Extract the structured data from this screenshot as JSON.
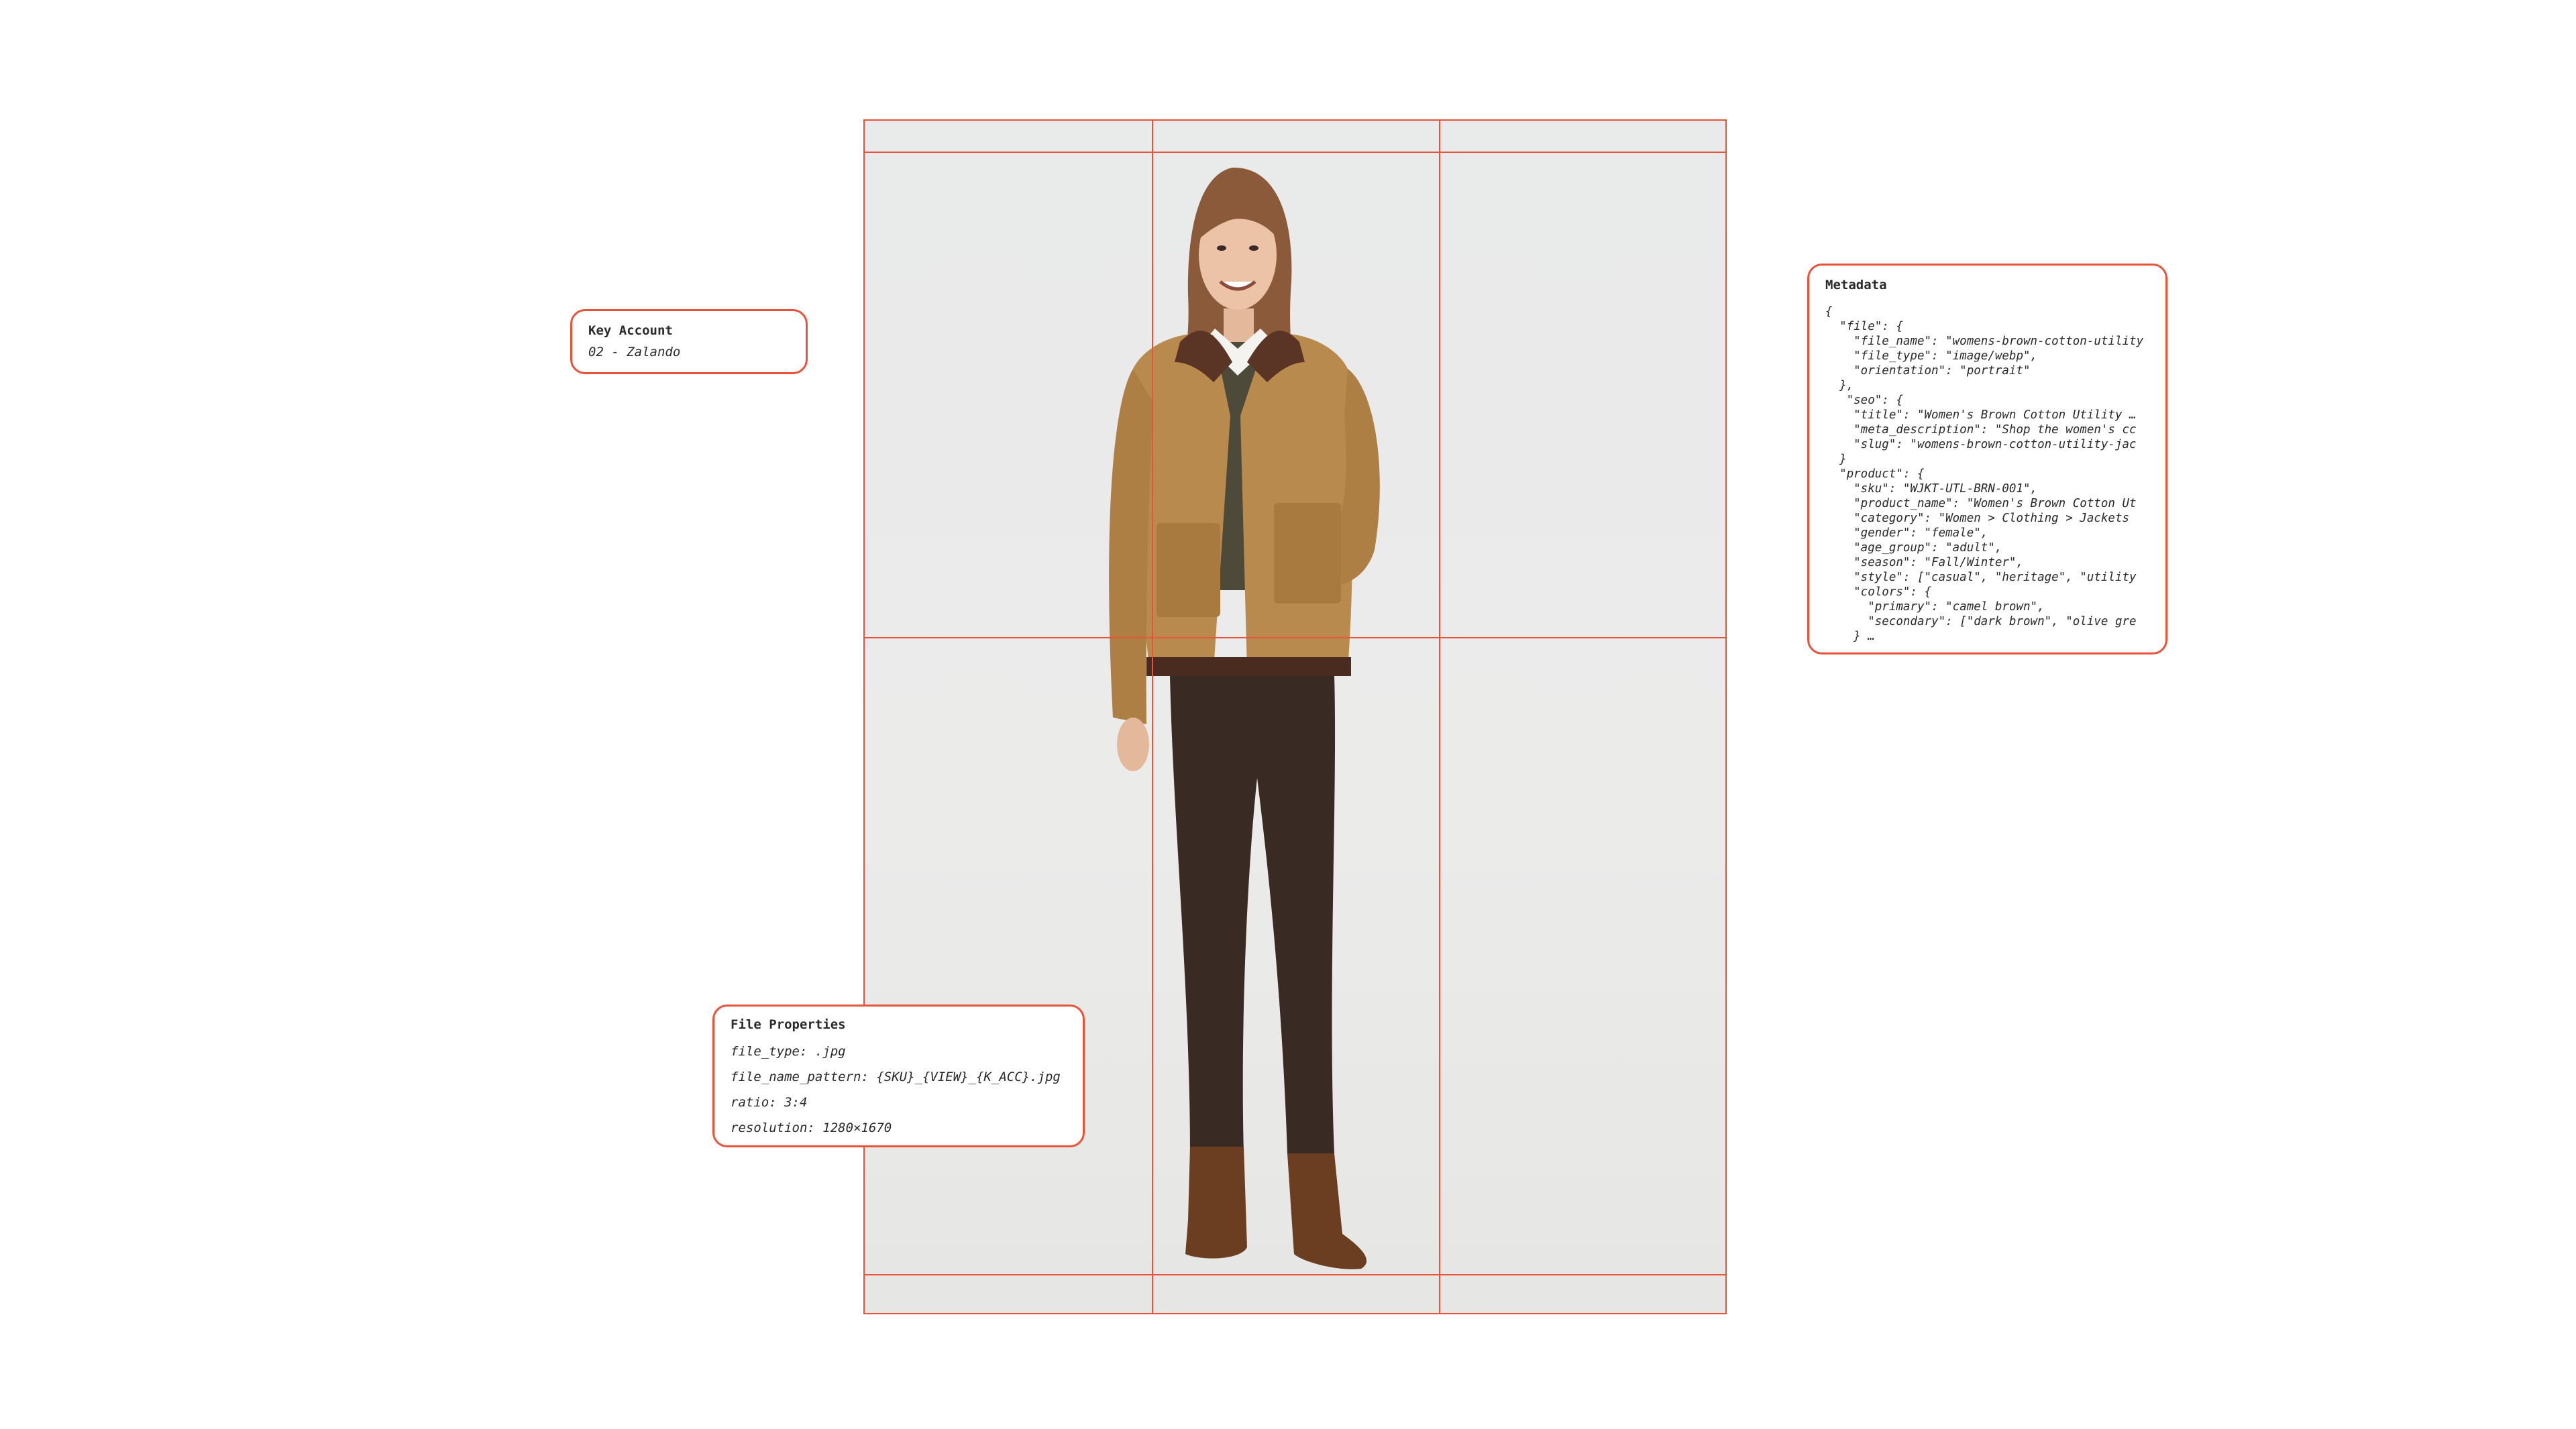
{
  "key_account": {
    "title": "Key Account",
    "value": "02 - Zalando"
  },
  "file_properties": {
    "title": "File Properties",
    "lines": [
      "file_type: .jpg",
      "file_name_pattern: {SKU}_{VIEW}_{K_ACC}.jpg",
      "ratio: 3:4",
      "resolution: 1280×1670"
    ]
  },
  "metadata": {
    "title": "Metadata",
    "lines": [
      "{",
      "  \"file\": {",
      "    \"file_name\": \"womens-brown-cotton-utility",
      "    \"file_type\": \"image/webp\",",
      "    \"orientation\": \"portrait\"",
      "  },",
      "   \"seo\": {",
      "    \"title\": \"Women's Brown Cotton Utility …",
      "    \"meta_description\": \"Shop the women's cc",
      "    \"slug\": \"womens-brown-cotton-utility-jac",
      "  }",
      "  \"product\": {",
      "    \"sku\": \"WJKT-UTL-BRN-001\",",
      "    \"product_name\": \"Women's Brown Cotton Ut",
      "    \"category\": \"Women > Clothing > Jackets",
      "    \"gender\": \"female\",",
      "    \"age_group\": \"adult\",",
      "    \"season\": \"Fall/Winter\",",
      "    \"style\": [\"casual\", \"heritage\", \"utility",
      "    \"colors\": {",
      "      \"primary\": \"camel brown\",",
      "      \"secondary\": [\"dark brown\", \"olive gre",
      "    } …"
    ]
  },
  "colors": {
    "accent": "#e8543a",
    "photo_background": "#e9eaea",
    "jacket": "#b98a4e",
    "trousers": "#3a2a24",
    "boots": "#6b3e22"
  },
  "icons": {
    "photo": "product-photo-model"
  }
}
